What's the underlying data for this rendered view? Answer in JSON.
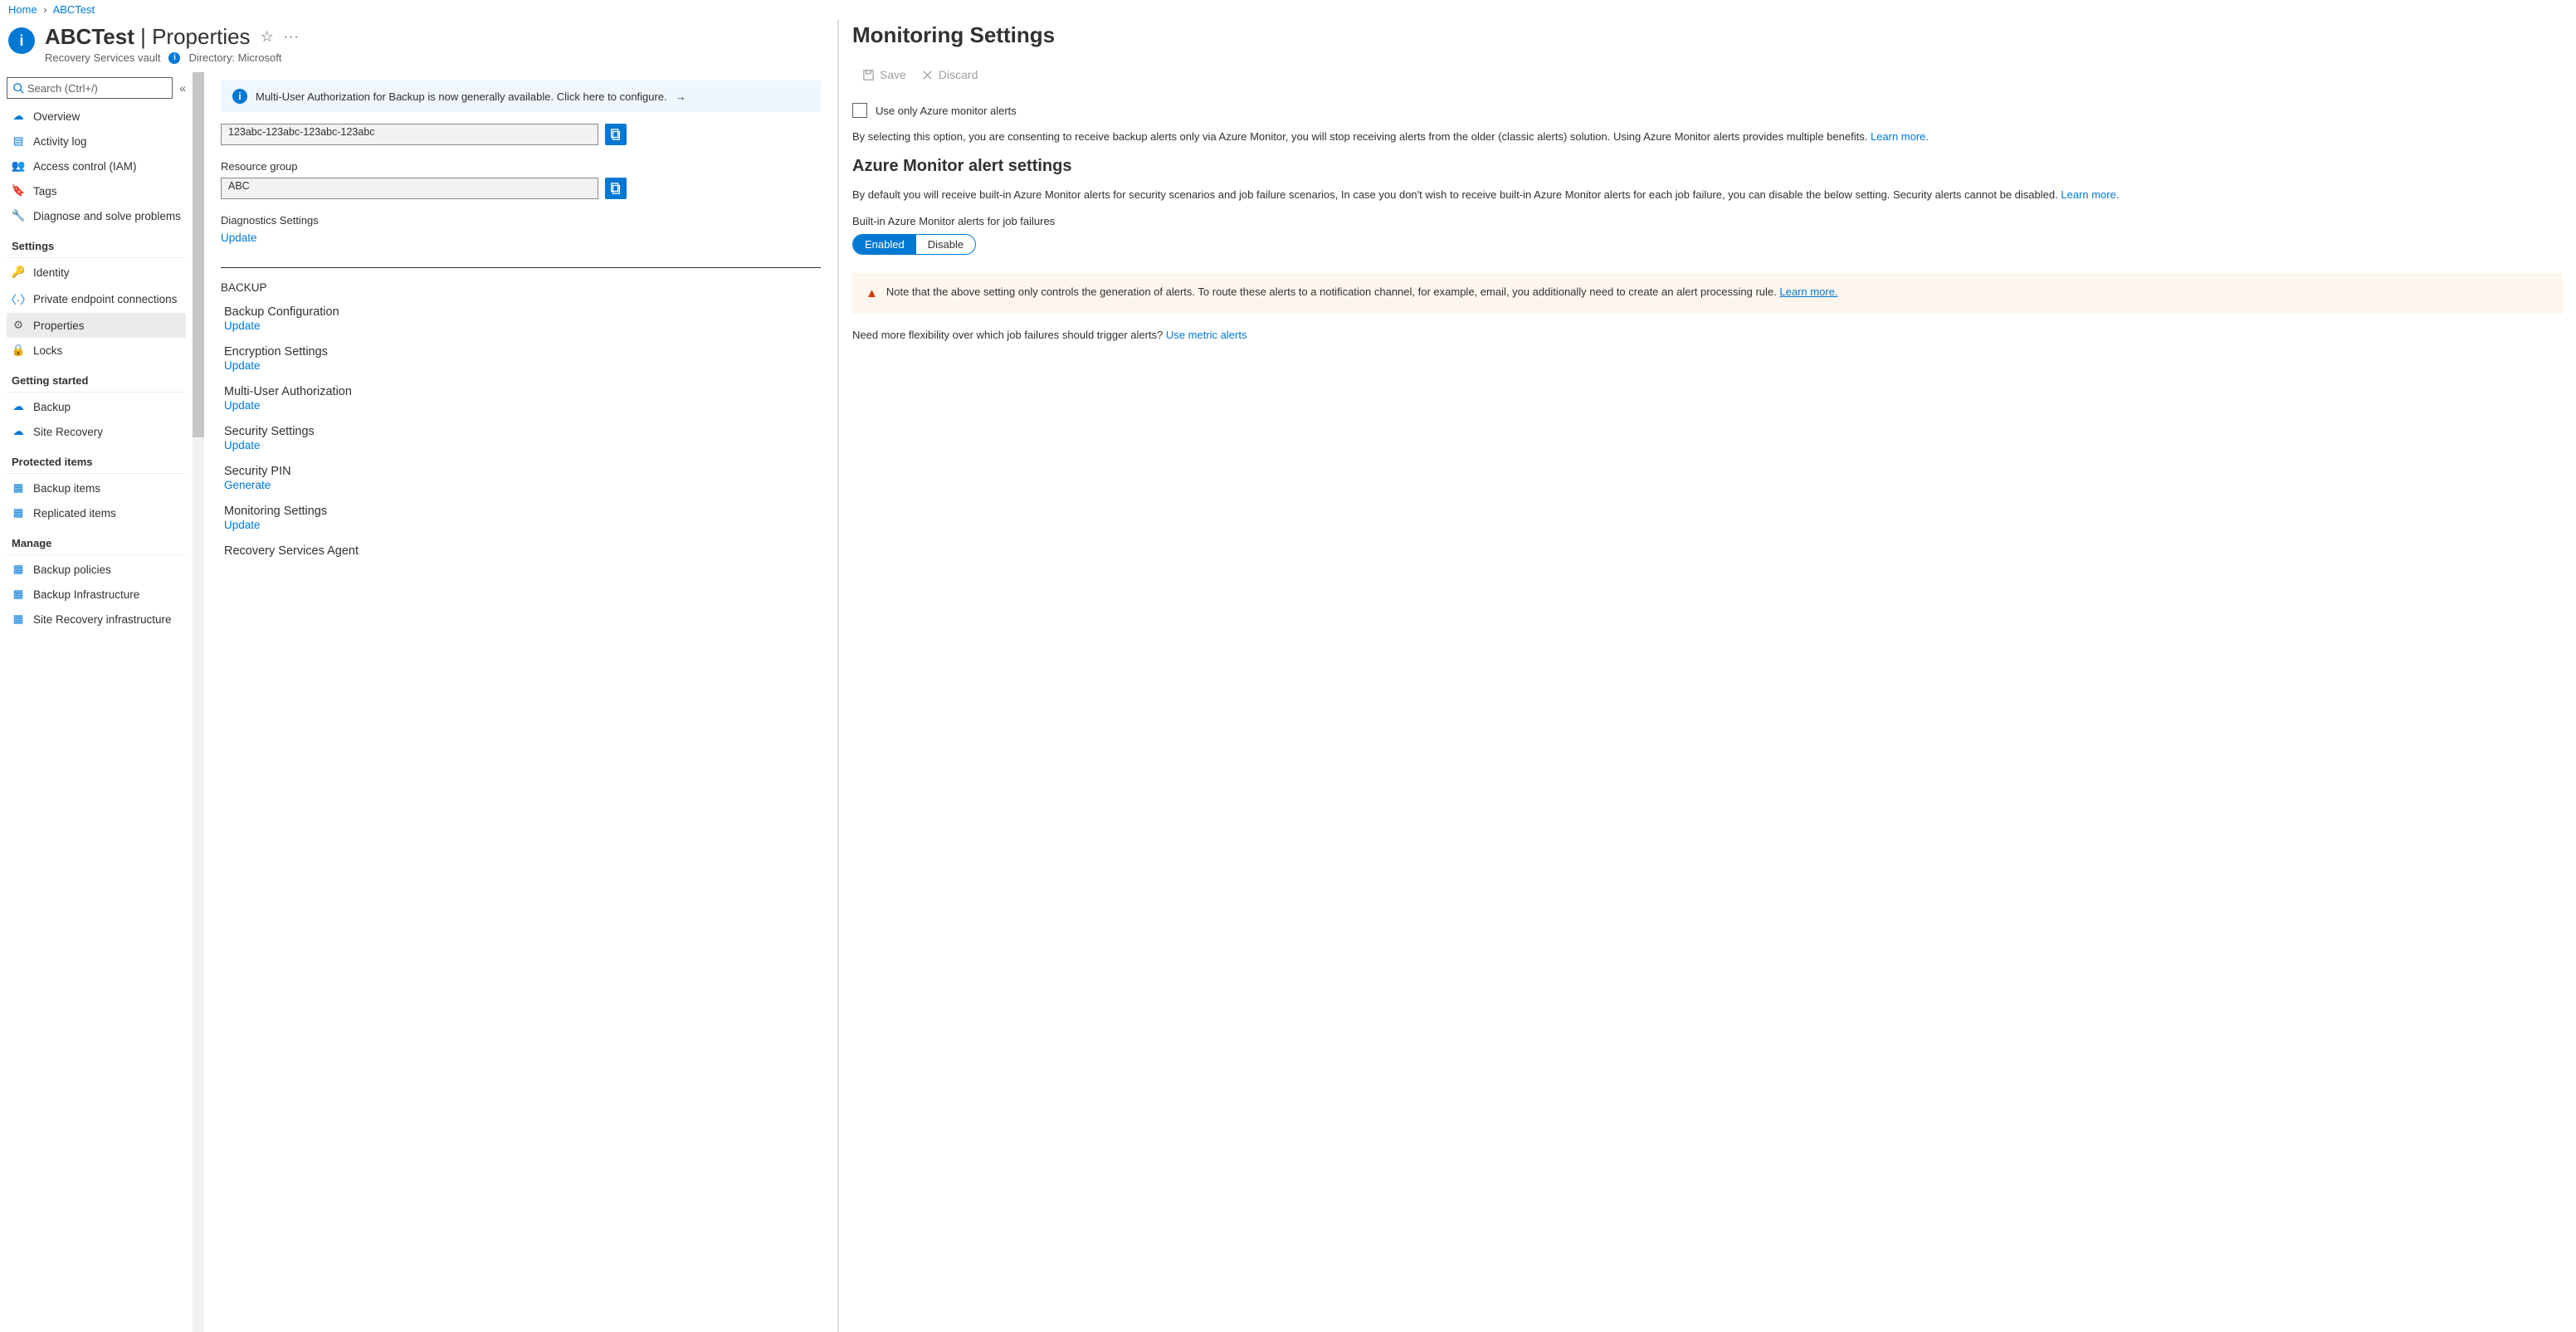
{
  "breadcrumb": {
    "home": "Home",
    "resource": "ABCTest"
  },
  "header": {
    "title_left": "ABCTest",
    "title_right": "Properties",
    "subtitle1": "Recovery Services vault",
    "subtitle2": "Directory: Microsoft"
  },
  "search": {
    "placeholder": "Search (Ctrl+/)"
  },
  "sidebar": {
    "top": [
      {
        "label": "Overview"
      },
      {
        "label": "Activity log"
      },
      {
        "label": "Access control (IAM)"
      },
      {
        "label": "Tags"
      },
      {
        "label": "Diagnose and solve problems"
      }
    ],
    "settings_head": "Settings",
    "settings": [
      {
        "label": "Identity"
      },
      {
        "label": "Private endpoint connections"
      },
      {
        "label": "Properties"
      },
      {
        "label": "Locks"
      }
    ],
    "getting_head": "Getting started",
    "getting": [
      {
        "label": "Backup"
      },
      {
        "label": "Site Recovery"
      }
    ],
    "protected_head": "Protected items",
    "protected": [
      {
        "label": "Backup items"
      },
      {
        "label": "Replicated items"
      }
    ],
    "manage_head": "Manage",
    "manage": [
      {
        "label": "Backup policies"
      },
      {
        "label": "Backup Infrastructure"
      },
      {
        "label": "Site Recovery infrastructure"
      }
    ]
  },
  "main": {
    "banner": "Multi-User Authorization for Backup is now generally available. Click here to configure.",
    "subscription_id": "123abc-123abc-123abc-123abc",
    "rg_label": "Resource group",
    "rg_value": "ABC",
    "diag_label": "Diagnostics Settings",
    "diag_action": "Update",
    "backup_section": "BACKUP",
    "groups": [
      {
        "label": "Backup Configuration",
        "action": "Update"
      },
      {
        "label": "Encryption Settings",
        "action": "Update"
      },
      {
        "label": "Multi-User Authorization",
        "action": "Update"
      },
      {
        "label": "Security Settings",
        "action": "Update"
      },
      {
        "label": "Security PIN",
        "action": "Generate"
      },
      {
        "label": "Monitoring Settings",
        "action": "Update"
      },
      {
        "label": "Recovery Services Agent",
        "action": ""
      }
    ]
  },
  "panel": {
    "title": "Monitoring Settings",
    "save": "Save",
    "discard": "Discard",
    "checkbox_label": "Use only Azure monitor alerts",
    "para1": "By selecting this option, you are consenting to receive backup alerts only via Azure Monitor, you will stop receiving alerts from the older (classic alerts) solution. Using Azure Monitor alerts provides multiple benefits.",
    "learn_more": "Learn more.",
    "subhead": "Azure Monitor alert settings",
    "para2": "By default you will receive built-in Azure Monitor alerts for security scenarios and job failure scenarios, In case you don't wish to receive built-in Azure Monitor alerts for each job failure, you can disable the below setting. Security alerts cannot be disabled.",
    "toggle_label": "Built-in Azure Monitor alerts for job failures",
    "enabled": "Enabled",
    "disable": "Disable",
    "warn": "Note that the above setting only controls the generation of alerts. To route these alerts to a notification channel, for example, email, you additionally need to create an alert processing rule.",
    "warn_link": "Learn more.",
    "footer_text": "Need more flexibility over which job failures should trigger alerts?",
    "footer_link": "Use metric alerts"
  }
}
